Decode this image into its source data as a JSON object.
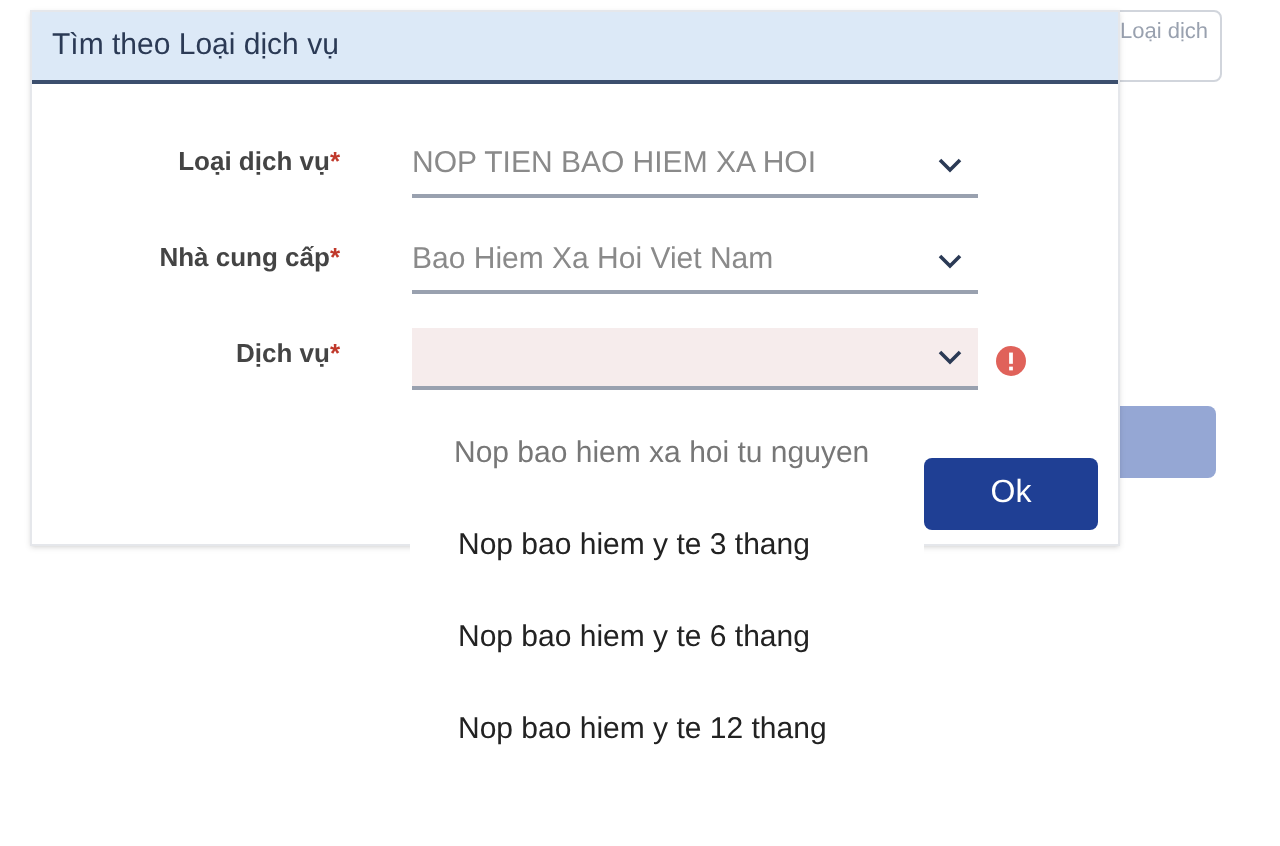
{
  "background_page": {
    "tab_label": "Loại dịch"
  },
  "dialog": {
    "title": "Tìm theo Loại dịch vụ",
    "fields": [
      {
        "label": "Loại dịch vụ",
        "required_mark": "*",
        "value": "NOP TIEN BAO HIEM XA HOI",
        "invalid": false
      },
      {
        "label": "Nhà cung cấp",
        "required_mark": "*",
        "value": "Bao Hiem Xa Hoi Viet Nam",
        "invalid": false
      },
      {
        "label": "Dịch vụ",
        "required_mark": "*",
        "invalid": true
      }
    ],
    "ok_button": "Ok"
  },
  "dropdown": {
    "options": [
      {
        "label": "Nop bao hiem xa hoi tu nguyen",
        "disabled": true
      },
      {
        "label": "Nop bao hiem y te 3 thang",
        "disabled": false
      },
      {
        "label": "Nop bao hiem y te 6 thang",
        "disabled": false
      },
      {
        "label": "Nop bao hiem y te 12 thang",
        "disabled": false
      }
    ]
  }
}
